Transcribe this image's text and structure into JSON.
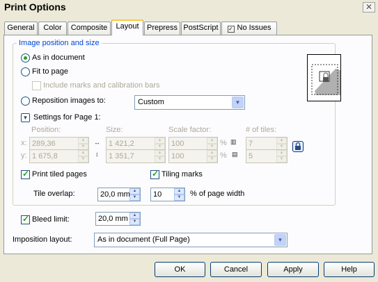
{
  "window": {
    "title": "Print Options",
    "close_label": "✕"
  },
  "tabs": [
    {
      "label": "General"
    },
    {
      "label": "Color"
    },
    {
      "label": "Composite"
    },
    {
      "label": "Layout"
    },
    {
      "label": "Prepress"
    },
    {
      "label": "PostScript"
    },
    {
      "label": "No Issues"
    }
  ],
  "position_group": {
    "legend": "Image position and size",
    "as_in_document": "As in document",
    "fit_to_page": "Fit to page",
    "include_marks": "Include marks and calibration bars",
    "reposition_label": "Reposition images to:",
    "reposition_value": "Custom",
    "settings_for_page": "Settings for Page 1:",
    "headers": {
      "position": "Position:",
      "size": "Size:",
      "scale": "Scale factor:",
      "tiles": "# of tiles:"
    },
    "x_label": "x:",
    "y_label": "y:",
    "pos_x": "289,36",
    "pos_y": "1 675,8",
    "size_w": "1 421,2",
    "size_h": "1 351,7",
    "scale_x": "100",
    "scale_y": "100",
    "pct1": "%",
    "pct2": "%",
    "tiles_x": "7",
    "tiles_y": "5",
    "print_tiled": "Print tiled pages",
    "tiling_marks": "Tiling marks",
    "tile_overlap_label": "Tile overlap:",
    "tile_overlap_value": "20,0 mm",
    "page_width_value": "10",
    "page_width_label": "% of page width"
  },
  "bleed": {
    "label": "Bleed limit:",
    "value": "20,0 mm"
  },
  "imposition": {
    "label": "Imposition layout:",
    "value": "As in document (Full Page)"
  },
  "buttons": {
    "ok": "OK",
    "cancel": "Cancel",
    "apply": "Apply",
    "help": "Help"
  }
}
